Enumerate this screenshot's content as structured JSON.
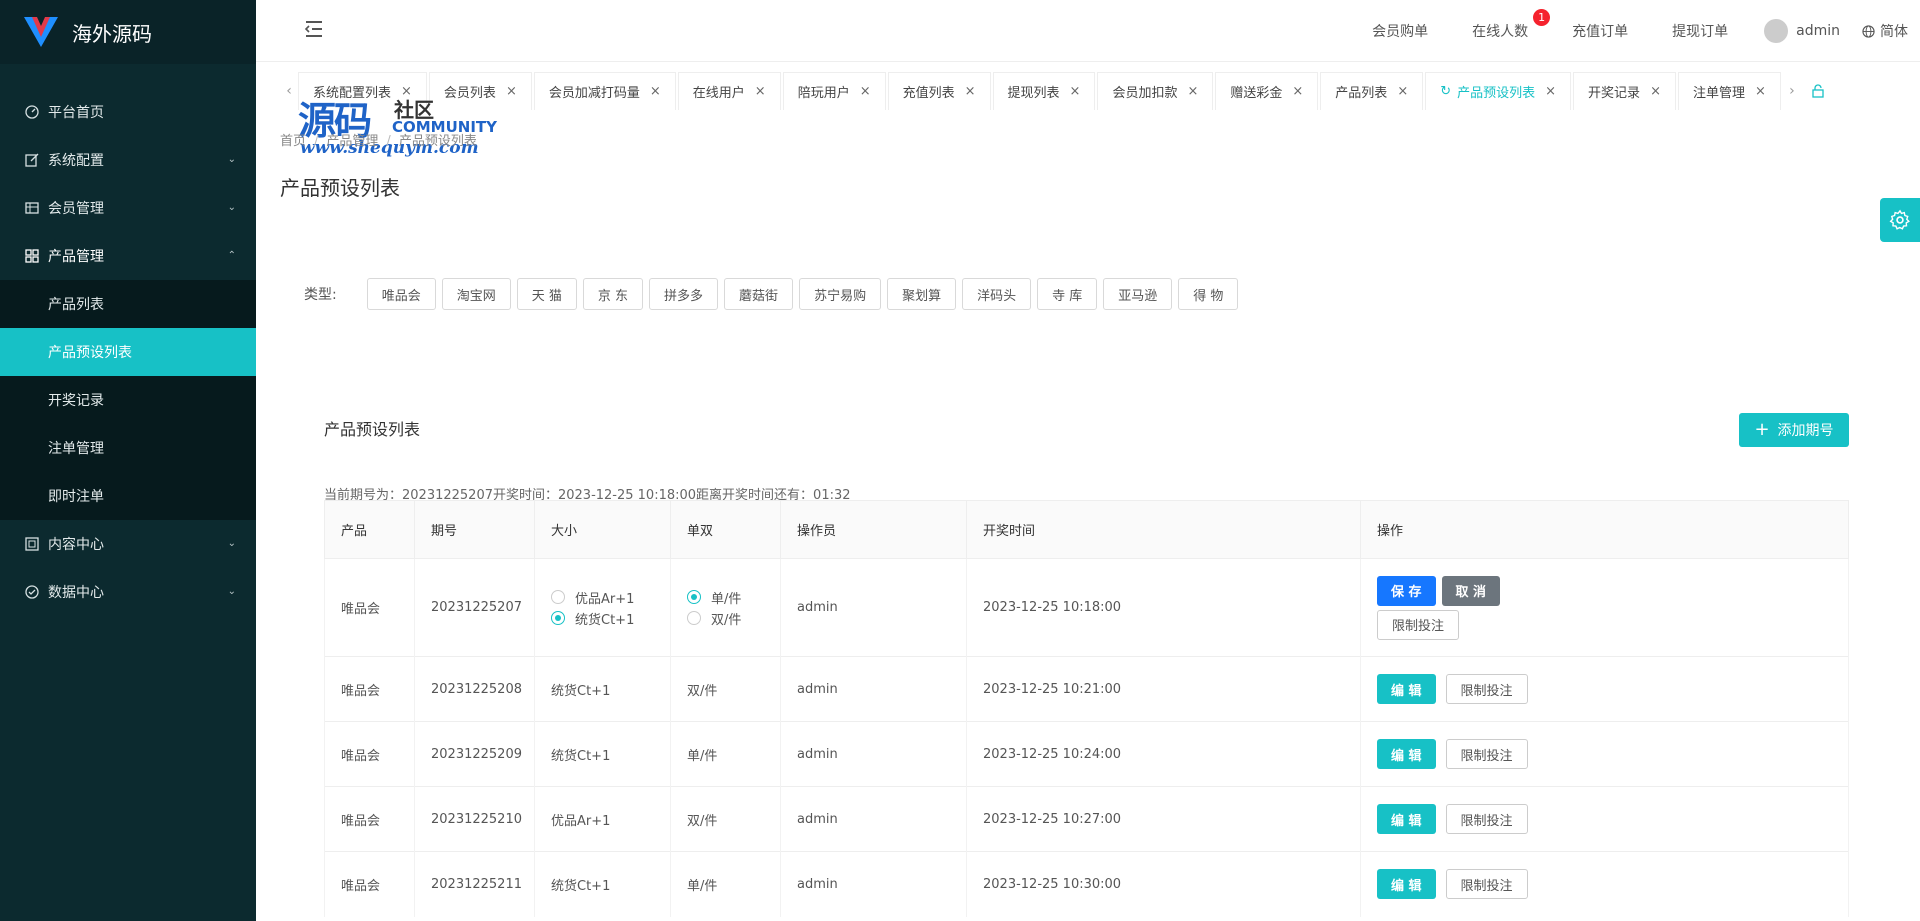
{
  "brand": {
    "name": "海外源码"
  },
  "sidebar": {
    "items": [
      {
        "label": "平台首页"
      },
      {
        "label": "系统配置"
      },
      {
        "label": "会员管理"
      },
      {
        "label": "产品管理"
      },
      {
        "label": "内容中心"
      },
      {
        "label": "数据中心"
      }
    ],
    "product_sub": [
      {
        "label": "产品列表"
      },
      {
        "label": "产品预设列表"
      },
      {
        "label": "开奖记录"
      },
      {
        "label": "注单管理"
      },
      {
        "label": "即时注单"
      }
    ]
  },
  "header": {
    "links": [
      "会员购单",
      "在线人数",
      "充值订单",
      "提现订单"
    ],
    "online_badge": "1",
    "user": "admin",
    "lang": "简体"
  },
  "tabs": [
    "系统配置列表",
    "会员列表",
    "会员加减打码量",
    "在线用户",
    "陪玩用户",
    "充值列表",
    "提现列表",
    "会员加扣款",
    "赠送彩金",
    "产品列表",
    "产品预设列表",
    "开奖记录",
    "注单管理"
  ],
  "watermark": {
    "big": "源码",
    "she": "社区",
    "community": "COMMUNITY",
    "url": "www.shequym.com"
  },
  "breadcrumb": [
    "首页",
    "产品管理",
    "产品预设列表"
  ],
  "page_title": "产品预设列表",
  "filter": {
    "label": "类型:",
    "types": [
      "唯品会",
      "淘宝网",
      "天 猫",
      "京 东",
      "拼多多",
      "蘑菇街",
      "苏宁易购",
      "聚划算",
      "洋码头",
      "寺 库",
      "亚马逊",
      "得 物"
    ]
  },
  "card": {
    "title": "产品预设列表",
    "add_label": "添加期号",
    "period_info": "当前期号为：20231225207开奖时间：2023-12-25 10:18:00距离开奖时间还有：01:32"
  },
  "table": {
    "columns": [
      "产品",
      "期号",
      "大小",
      "单双",
      "操作员",
      "开奖时间",
      "操作"
    ],
    "editing_row": {
      "product": "唯品会",
      "period": "20231225207",
      "size_options": [
        "优品Ar+1",
        "统货Ct+1"
      ],
      "size_selected": 1,
      "parity_options": [
        "单/件",
        "双/件"
      ],
      "parity_selected": 0,
      "operator": "admin",
      "time": "2023-12-25 10:18:00",
      "save": "保 存",
      "cancel": "取 消",
      "limit": "限制投注"
    },
    "rows": [
      {
        "product": "唯品会",
        "period": "20231225208",
        "size": "统货Ct+1",
        "parity": "双/件",
        "operator": "admin",
        "time": "2023-12-25 10:21:00",
        "edit": "编 辑",
        "limit": "限制投注"
      },
      {
        "product": "唯品会",
        "period": "20231225209",
        "size": "统货Ct+1",
        "parity": "单/件",
        "operator": "admin",
        "time": "2023-12-25 10:24:00",
        "edit": "编 辑",
        "limit": "限制投注"
      },
      {
        "product": "唯品会",
        "period": "20231225210",
        "size": "优品Ar+1",
        "parity": "双/件",
        "operator": "admin",
        "time": "2023-12-25 10:27:00",
        "edit": "编 辑",
        "limit": "限制投注"
      },
      {
        "product": "唯品会",
        "period": "20231225211",
        "size": "统货Ct+1",
        "parity": "单/件",
        "operator": "admin",
        "time": "2023-12-25 10:30:00",
        "edit": "编 辑",
        "limit": "限制投注"
      }
    ]
  },
  "colors": {
    "accent": "#17c1c6",
    "sidebar": "#0c2a2f",
    "primary": "#1677ff"
  }
}
